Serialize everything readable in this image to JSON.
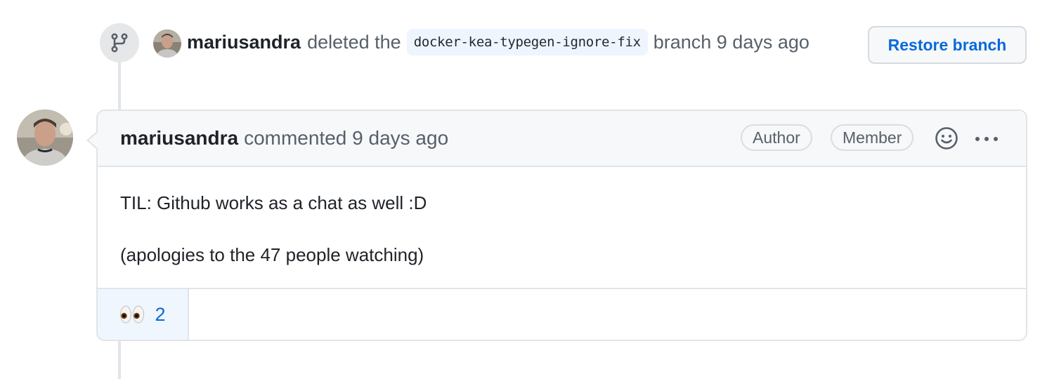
{
  "branch_event": {
    "icon": "git-branch-icon",
    "author": "mariusandra",
    "action": "deleted the",
    "branch_name": "docker-kea-typegen-ignore-fix",
    "suffix": "branch 9 days ago",
    "restore_button_label": "Restore branch"
  },
  "comment": {
    "author": "mariusandra",
    "action": "commented 9 days ago",
    "labels": [
      "Author",
      "Member"
    ],
    "react_icon": "smiley-icon",
    "more_icon": "kebab-horizontal-icon",
    "body": [
      "TIL: Github works as a chat as well :D",
      "(apologies to the 47 people watching)"
    ],
    "reactions": [
      {
        "emoji": "eyes",
        "count": "2"
      }
    ]
  },
  "colors": {
    "link_blue": "#0969da",
    "border": "#e1e4e8",
    "header_bg": "#f6f8fa",
    "reaction_bg": "#eff6fe"
  }
}
